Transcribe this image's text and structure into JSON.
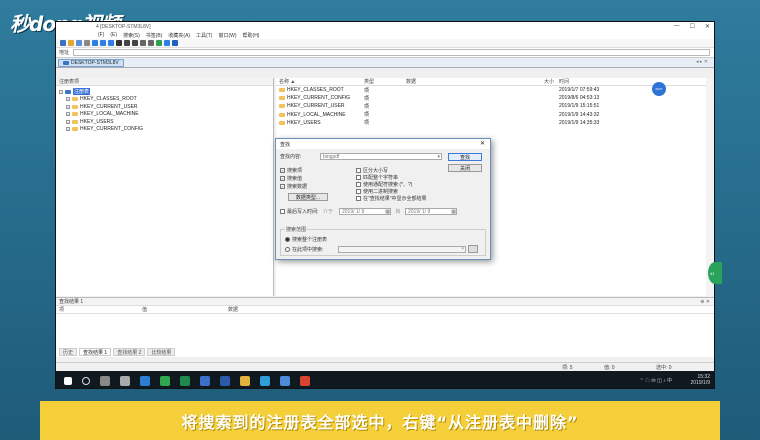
{
  "brand": {
    "logo_text": "秒dong视频"
  },
  "window": {
    "title_prefix": "4",
    "title": "[DESKTOP-STM3L8V]",
    "controls": {
      "minimize": "—",
      "maximize": "☐",
      "close": "✕"
    }
  },
  "menu": [
    "(F)",
    "(E)",
    "搜索(S)",
    "书签(B)",
    "收藏夹(A)",
    "工具(T)",
    "窗口(W)",
    "帮助(H)"
  ],
  "address": {
    "label": "地址",
    "value": ""
  },
  "tab": {
    "label": "DESKTOP-STM3L8V",
    "nav": "◂ ▸ ✕"
  },
  "left_pane": {
    "header": "注册表项",
    "root": "注册表",
    "items": [
      "HKEY_CLASSES_ROOT",
      "HKEY_CURRENT_USER",
      "HKEY_LOCAL_MACHINE",
      "HKEY_USERS",
      "HKEY_CURRENT_CONFIG"
    ]
  },
  "list": {
    "columns": {
      "name": "名称 ▲",
      "type": "类型",
      "data": "数据",
      "size": "大小",
      "time": "时间"
    },
    "rows": [
      {
        "name": "HKEY_CLASSES_ROOT",
        "type": "项",
        "time": "2019/1/7 07:59:43"
      },
      {
        "name": "HKEY_CURRENT_CONFIG",
        "type": "项",
        "time": "2019/8/6 04:53:13"
      },
      {
        "name": "HKEY_CURRENT_USER",
        "type": "项",
        "time": "2019/1/9 15:15:51"
      },
      {
        "name": "HKEY_LOCAL_MACHINE",
        "type": "项",
        "time": "2019/1/9 14:43:32"
      },
      {
        "name": "HKEY_USERS",
        "type": "项",
        "time": "2019/1/9 14:35:33"
      }
    ]
  },
  "badge": {
    "blue": "0047",
    "green": "41"
  },
  "dialog": {
    "title": "查找",
    "close": "✕",
    "search_label": "查找内容:",
    "search_value": "bingpdf",
    "find_button": "查找",
    "close_button": "关闭",
    "left_checks": [
      {
        "label": "搜索项",
        "checked": true
      },
      {
        "label": "搜索值",
        "checked": true
      },
      {
        "label": "搜索数据",
        "checked": true
      }
    ],
    "right_checks": [
      {
        "label": "区分大小写",
        "checked": false
      },
      {
        "label": "匹配整个字符串",
        "checked": false
      },
      {
        "label": "使用通配符搜索 (*、?)",
        "checked": false
      },
      {
        "label": "使用二进制搜索",
        "checked": false
      },
      {
        "label": "在\"查找结果\"中显示全部结果",
        "checked": false
      }
    ],
    "datatype_button": "数据类型...",
    "last_modified_label": "最后写入时间:",
    "from_label": "介于",
    "from_date": "2019/ 1/ 9",
    "and_label": "和",
    "to_date": "2019/ 1/ 9",
    "scope": {
      "title": "搜索范围",
      "option1": "搜索整个注册表",
      "option2": "在此项中搜索:",
      "option2_value": ""
    }
  },
  "results": {
    "header": "查找结果 1",
    "pin": "⊕ ✕",
    "columns": {
      "name": "项",
      "value": "值",
      "data": "数据"
    }
  },
  "bottom_tabs": [
    "历史",
    "查找结果 1",
    "查找结果 2",
    "比较结果"
  ],
  "status": {
    "items": "项: 5",
    "values": "值: 0",
    "selected": "选中: 0"
  },
  "taskbar": {
    "tray_icons": "⌃ ☁ ✉ ◫ ♪ 中",
    "time": "15:32",
    "date": "2019/1/9"
  },
  "caption": "将搜索到的注册表全部选中，右键“从注册表中删除”",
  "colors": {
    "accent": "#3a6fd8",
    "caption_bg": "#f4cf3a",
    "frame": "#2a6f8f",
    "taskbar": "#101820"
  }
}
